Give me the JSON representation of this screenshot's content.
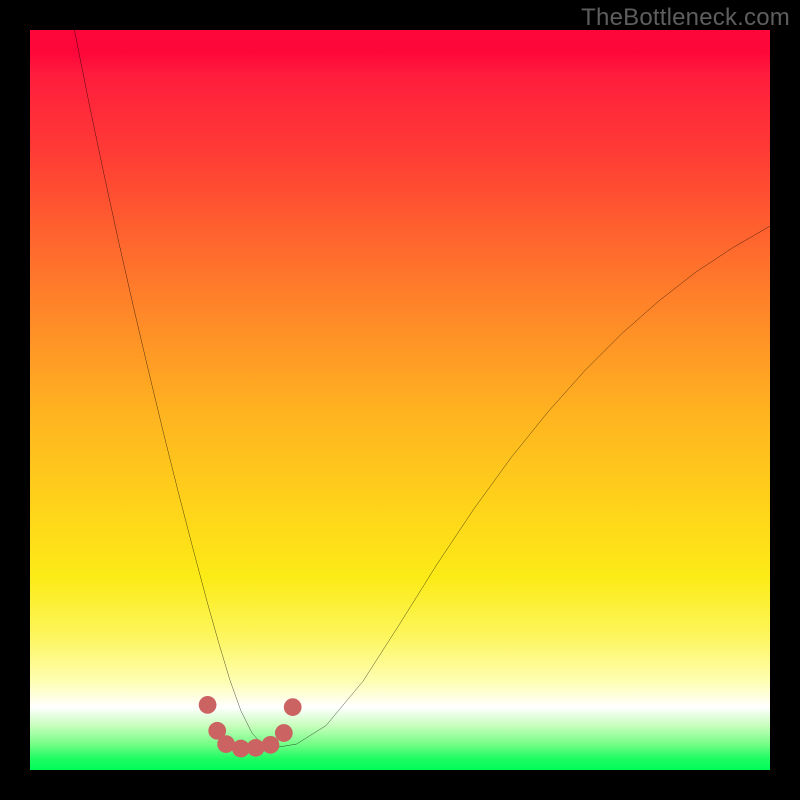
{
  "watermark": "TheBottleneck.com",
  "chart_data": {
    "type": "line",
    "title": "",
    "xlabel": "",
    "ylabel": "",
    "xlim": [
      0,
      100
    ],
    "ylim": [
      0,
      100
    ],
    "gradient_stops": [
      {
        "pct": 0,
        "color": "#fd073a"
      },
      {
        "pct": 18,
        "color": "#ff4034"
      },
      {
        "pct": 42,
        "color": "#ff9426"
      },
      {
        "pct": 64,
        "color": "#ffd21a"
      },
      {
        "pct": 82,
        "color": "#fdf65e"
      },
      {
        "pct": 91.5,
        "color": "#ffffff"
      },
      {
        "pct": 96.5,
        "color": "#75fd87"
      },
      {
        "pct": 100,
        "color": "#00fc58"
      }
    ],
    "series": [
      {
        "name": "bottleneck-curve",
        "x": [
          6,
          8,
          10,
          12,
          14,
          16,
          18,
          20,
          22,
          24,
          25.5,
          27,
          28.5,
          30,
          31.5,
          33,
          36,
          40,
          45,
          50,
          55,
          60,
          65,
          70,
          75,
          80,
          85,
          90,
          95,
          100
        ],
        "y": [
          100,
          90,
          80.5,
          71.3,
          62.5,
          54,
          45.7,
          37.7,
          30,
          22.5,
          17.2,
          12.2,
          8,
          5,
          3.3,
          3,
          3.5,
          6,
          12,
          19.8,
          27.8,
          35.3,
          42.2,
          48.4,
          54,
          59,
          63.4,
          67.3,
          70.6,
          73.5
        ]
      }
    ],
    "markers": {
      "name": "valley-dots",
      "color": "#cb6363",
      "radius_pct": 1.2,
      "points": [
        {
          "x": 24.0,
          "y": 8.8
        },
        {
          "x": 25.3,
          "y": 5.3
        },
        {
          "x": 26.5,
          "y": 3.5
        },
        {
          "x": 28.5,
          "y": 2.9
        },
        {
          "x": 30.5,
          "y": 3.0
        },
        {
          "x": 32.5,
          "y": 3.4
        },
        {
          "x": 34.3,
          "y": 5.0
        },
        {
          "x": 35.5,
          "y": 8.5
        }
      ]
    }
  }
}
